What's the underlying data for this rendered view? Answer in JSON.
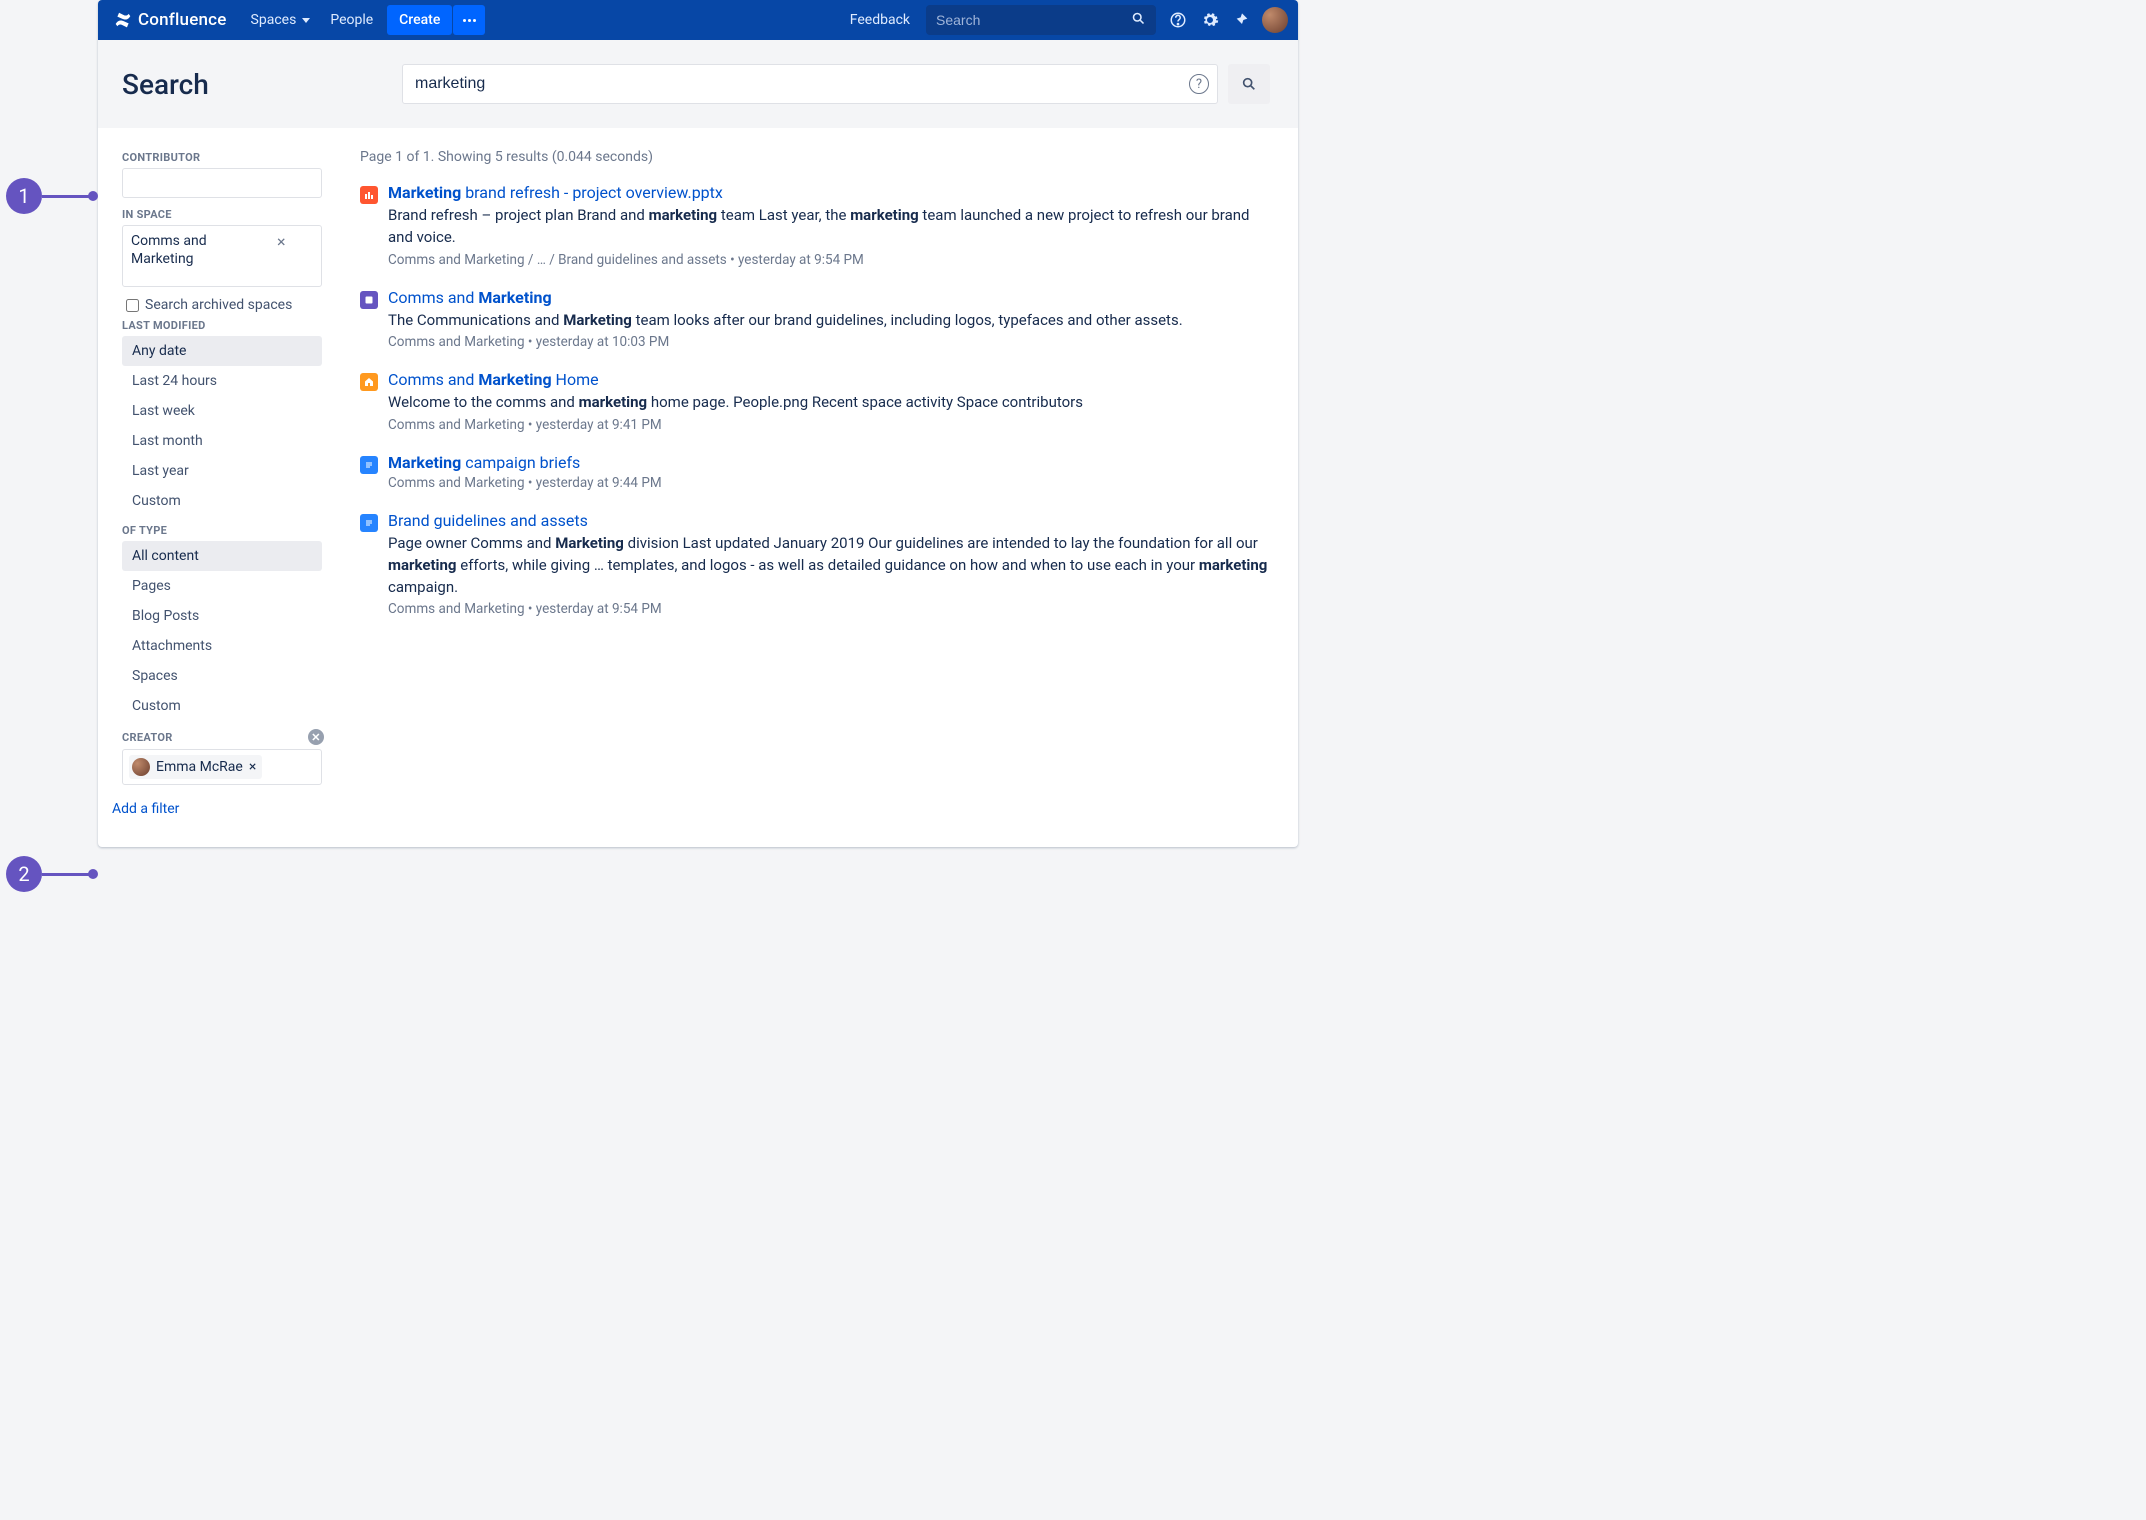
{
  "annotations": {
    "one": "1",
    "two": "2"
  },
  "nav": {
    "brand": "Confluence",
    "spaces": "Spaces",
    "people": "People",
    "create": "Create",
    "feedback": "Feedback",
    "search_placeholder": "Search"
  },
  "searchHeader": {
    "title": "Search",
    "query": "marketing"
  },
  "sidebar": {
    "contributor_label": "CONTRIBUTOR",
    "in_space_label": "IN SPACE",
    "space_chip": "Comms and Marketing",
    "archived_label": "Search archived spaces",
    "last_modified_label": "LAST MODIFIED",
    "last_modified": [
      "Any date",
      "Last 24 hours",
      "Last week",
      "Last month",
      "Last year",
      "Custom"
    ],
    "of_type_label": "OF TYPE",
    "of_type": [
      "All content",
      "Pages",
      "Blog Posts",
      "Attachments",
      "Spaces",
      "Custom"
    ],
    "creator_label": "CREATOR",
    "creator_chip": "Emma McRae",
    "add_filter": "Add a filter"
  },
  "results_meta": "Page 1 of 1. Showing 5 results (0.044 seconds)",
  "results": [
    {
      "icon": "ppt",
      "title_html": "<b>Marketing</b> brand refresh - project overview.pptx",
      "snippet_html": "Brand refresh – project plan Brand and <b>marketing</b> team Last year, the <b>marketing</b> team launched a new project to refresh our brand and voice.",
      "crumb": "Comms and Marketing / … / Brand guidelines and assets • yesterday at 9:54 PM"
    },
    {
      "icon": "space-purple",
      "title_html": "Comms and <b>Marketing</b>",
      "snippet_html": "The Communications and <b>Marketing</b> team looks after our brand guidelines, including logos, typefaces and other assets.",
      "crumb": "Comms and Marketing • yesterday at 10:03 PM"
    },
    {
      "icon": "home",
      "title_html": "Comms and <b>Marketing</b> Home",
      "snippet_html": "Welcome to the comms and <b>marketing</b> home page. People.png Recent space activity Space contributors",
      "crumb": "Comms and Marketing • yesterday at 9:41 PM"
    },
    {
      "icon": "page",
      "title_html": "<b>Marketing</b> campaign briefs",
      "snippet_html": "",
      "crumb": "Comms and Marketing • yesterday at 9:44 PM"
    },
    {
      "icon": "page",
      "title_html": "Brand guidelines and assets",
      "snippet_html": "Page owner Comms and <b>Marketing</b> division Last updated January 2019 Our guidelines are intended to lay the foundation for all our <b>marketing</b> efforts, while giving … templates, and logos - as well as detailed guidance on how and when to use each in your <b>marketing</b> campaign.",
      "crumb": "Comms and Marketing • yesterday at 9:54 PM"
    }
  ]
}
